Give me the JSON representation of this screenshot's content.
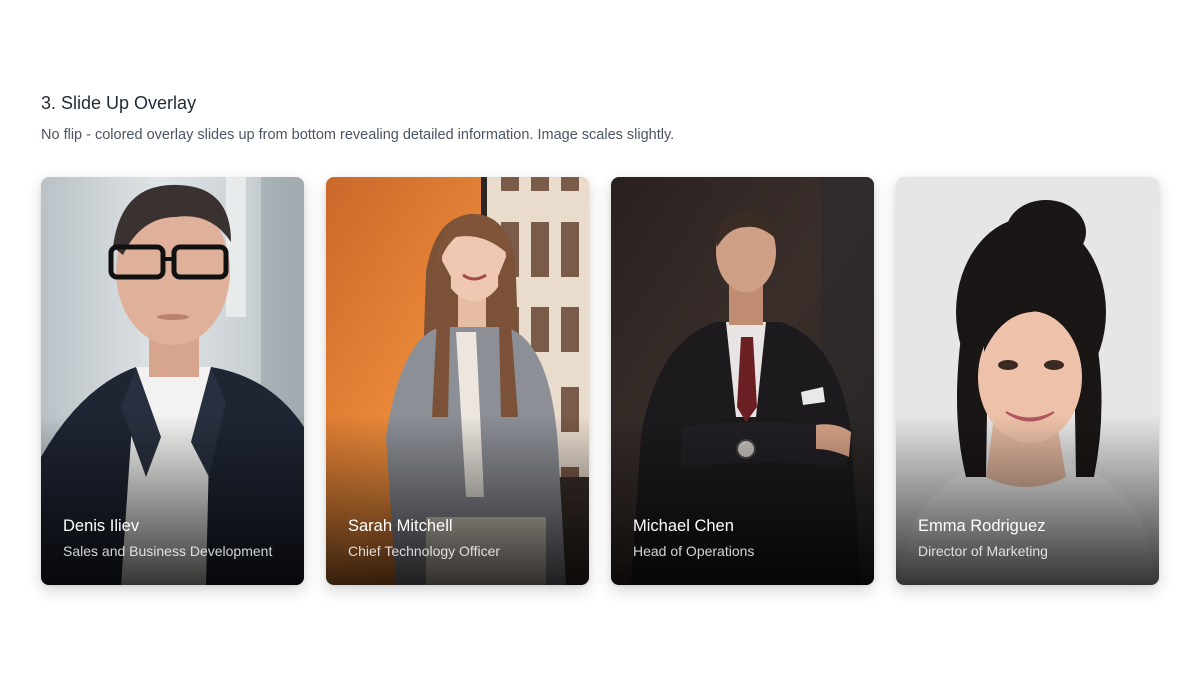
{
  "section": {
    "title": "3. Slide Up Overlay",
    "description": "No flip - colored overlay slides up from bottom revealing detailed information. Image scales slightly."
  },
  "cards": [
    {
      "name": "Denis Iliev",
      "role": "Sales and Business Development"
    },
    {
      "name": "Sarah Mitchell",
      "role": "Chief Technology Officer"
    },
    {
      "name": "Michael Chen",
      "role": "Head of Operations"
    },
    {
      "name": "Emma Rodriguez",
      "role": "Director of Marketing"
    }
  ]
}
